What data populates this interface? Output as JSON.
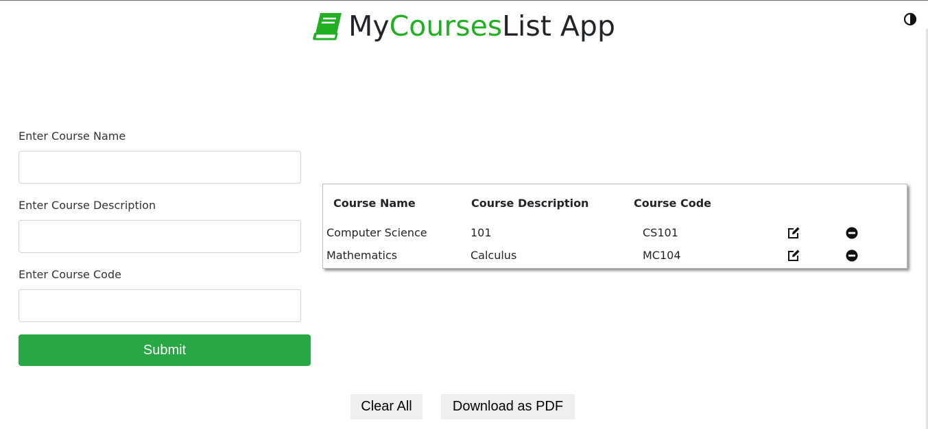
{
  "header": {
    "title_prefix": "My ",
    "title_accent": "Courses",
    "title_suffix": " List App",
    "accent_color": "#21b021",
    "book_icon": "book-icon",
    "theme_icon": "contrast-icon"
  },
  "form": {
    "course_name_label": "Enter Course Name",
    "course_name_value": "",
    "course_description_label": "Enter Course Description",
    "course_description_value": "",
    "course_code_label": "Enter Course Code",
    "course_code_value": "",
    "submit_label": "Submit",
    "submit_color": "#28a745"
  },
  "table": {
    "headers": [
      "Course Name",
      "Course Description",
      "Course Code"
    ],
    "rows": [
      {
        "name": "Computer Science",
        "description": "101",
        "code": "CS101",
        "edit_icon": "edit-icon",
        "delete_icon": "minus-circle-icon"
      },
      {
        "name": "Mathematics",
        "description": "Calculus",
        "code": "MC104",
        "edit_icon": "edit-icon",
        "delete_icon": "minus-circle-icon"
      }
    ]
  },
  "actions": {
    "clear_all_label": "Clear All",
    "download_pdf_label": "Download as PDF"
  }
}
